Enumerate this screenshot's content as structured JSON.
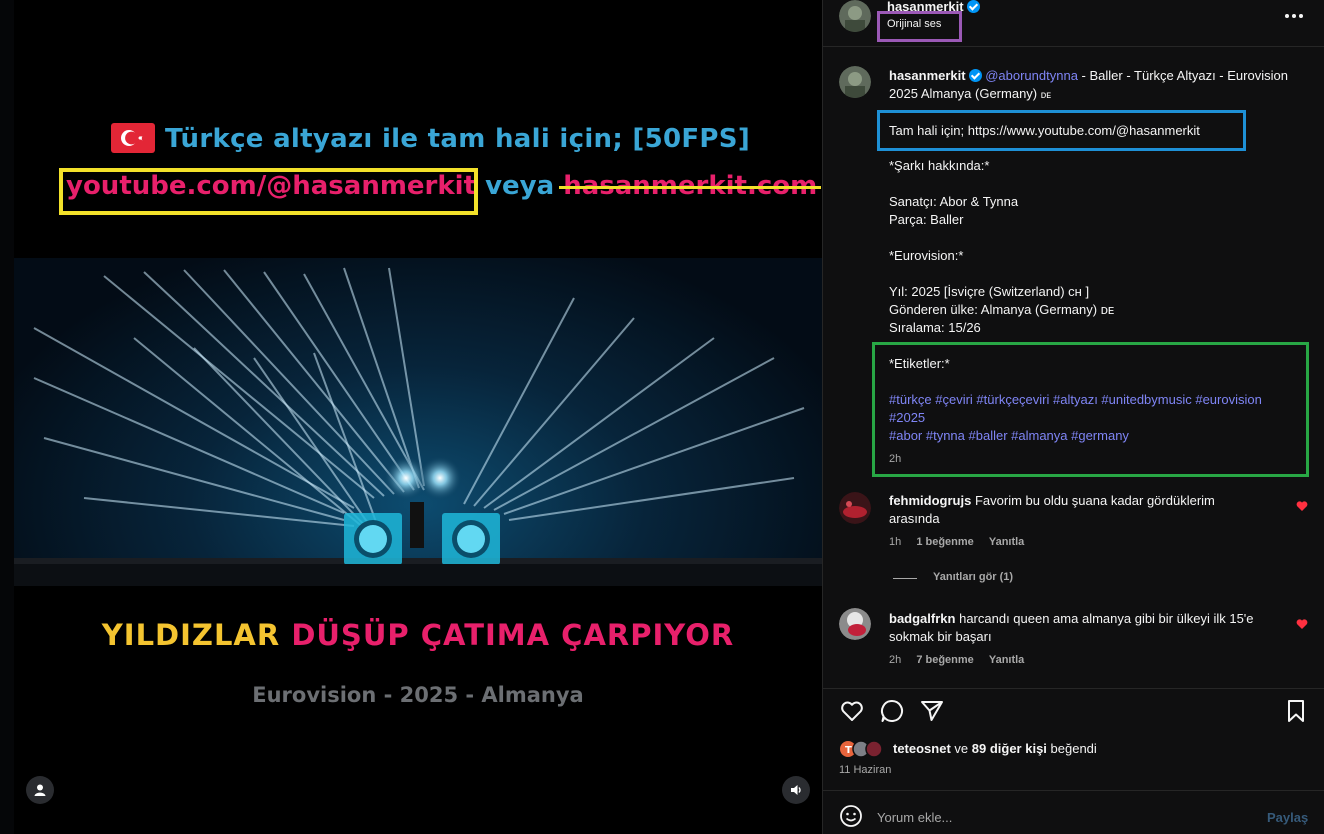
{
  "video": {
    "overlay_line1": "Türkçe altyazı ile tam hali için; [50FPS]",
    "overlay_link": "youtube.com/@hasanmerkit",
    "overlay_or": "veya",
    "overlay_struck": "hasanmerkit.com",
    "lyric_part1": "YILDIZLAR",
    "lyric_part2": "DÜŞÜP ÇATIMA ÇARPIYOR",
    "caption": "Eurovision - 2025 - Almanya",
    "colors": {
      "link": "#e8206b",
      "accent_blue": "#3aa6d6",
      "highlight_yellow": "#f2e12a"
    },
    "icons": {
      "user": "user-icon",
      "sound": "speaker-icon"
    }
  },
  "header": {
    "username": "hasanmerkit",
    "audio_label": "Orijinal ses",
    "more_icon": "more-horizontal-icon"
  },
  "post": {
    "username": "hasanmerkit",
    "mention": "@aborundtynna",
    "title_rest": " - Baller - Türkçe Altyazı - Eurovision 2025 Almanya (Germany) ",
    "title_flag": "ᴅᴇ",
    "full_link": "Tam hali için; https://www.youtube.com/@hasanmerkit",
    "song_header": "*Şarkı hakkında:*",
    "artist": "Sanatçı: Abor & Tynna",
    "track": "Parça: Baller",
    "eurovision_header": "*Eurovision:*",
    "year": "Yıl: 2025 [İsviçre (Switzerland) ᴄʜ ]",
    "country": "Gönderen ülke: Almanya (Germany) ᴅᴇ",
    "rank": "Sıralama: 15/26",
    "tags_header": "*Etiketler:*",
    "tags_line1": "#türkçe #çeviri #türkçeçeviri #altyazı #unitedbymusic #eurovision",
    "tags_line2": "#2025",
    "tags_line3": "#abor #tynna #baller #almanya #germany",
    "time": "2h",
    "box_colors": {
      "audio": "#9b59b6",
      "link": "#1e90d6",
      "tags": "#28a745"
    }
  },
  "comments": [
    {
      "username": "fehmidogrujs",
      "text_line1": "Favorim bu oldu şuana kadar gördüklerim",
      "text_line2": "arasında",
      "time": "1h",
      "likes": "1 beğenme",
      "reply": "Yanıtla",
      "view_replies": "Yanıtları gör (1)"
    },
    {
      "username": "badgalfrkn",
      "text_line1": "harcandı queen ama almanya gibi bir ülkeyi ilk 15'e",
      "text_line2": "sokmak bir başarı",
      "time": "2h",
      "likes": "7 beğenme",
      "reply": "Yanıtla"
    }
  ],
  "actions": {
    "icons": [
      "heart-icon",
      "comment-icon",
      "share-icon",
      "bookmark-icon"
    ],
    "liked_by_user": "teteosnet",
    "liked_by_rest": " ve ",
    "liked_by_others": "89 diğer kişi",
    "liked_by_suffix": " beğendi",
    "date": "11 Haziran"
  },
  "composer": {
    "placeholder": "Yorum ekle...",
    "post_label": "Paylaş",
    "emoji_icon": "emoji-icon"
  }
}
